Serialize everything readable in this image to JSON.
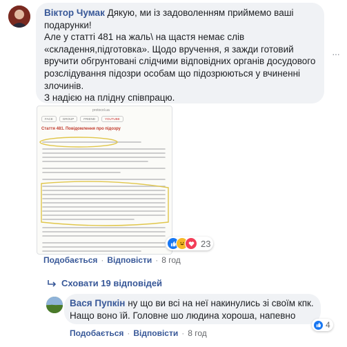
{
  "comment": {
    "author": "Віктор Чумак",
    "text": "Дякую, ми із задоволенням приймемо ваші подарунки!\nАле у статті 481 на жаль\\ на щастя немає слів «складення,підготовка». Щодо вручення, я зажди готовий вручити обгрунтовані слідчими відповідних органів досудового розслідування підозри особам що підозрюються у вчиненні злочинів.\nЗ надією на плідну співпрацю.",
    "reactions_count": "23",
    "actions": {
      "like": "Подобається",
      "reply": "Відповісти",
      "time": "8 год",
      "separator": "·"
    },
    "attachment": {
      "site": "protocol.ua",
      "tabs": [
        "FACE",
        "GROUP",
        "FRIEND",
        "YOUTUBE"
      ],
      "heading": "Стаття 481. Повідомлення про підозру"
    }
  },
  "hide_replies": {
    "label": "Сховати 19 відповідей"
  },
  "reply": {
    "author": "Вася Пупкін",
    "text": "ну що ви всі на неї накинулись зі своїм кпк.\nНащо воно їй. Головне шо людина хороша, напевно",
    "reactions_count": "4",
    "actions": {
      "like": "Подобається",
      "reply": "Відповісти",
      "time": "8 год",
      "separator": "·"
    }
  },
  "colors": {
    "link": "#385898",
    "bubble": "#f0f2f5",
    "meta": "#65676b",
    "like": "#1877f2"
  }
}
